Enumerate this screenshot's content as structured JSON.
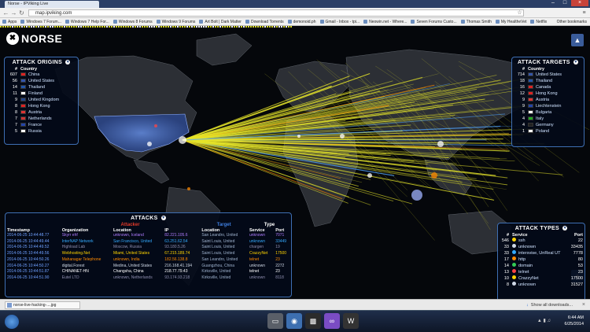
{
  "browser": {
    "tab_title": "Norse - IPViking Live",
    "url": "map.ipviking.com",
    "minimize": "–",
    "maximize": "□",
    "close": "×",
    "back": "←",
    "forward": "→",
    "reload": "↻",
    "star": "☆",
    "menu": "≡",
    "bookmarks": [
      "Apps",
      "Windows 7 Forum...",
      "Windows 7 Help For...",
      "Windows 8 Forums",
      "Windows 9 Forums",
      "Art Bolt | Dark Matter",
      "Download Torrents",
      "demonoid.ph",
      "Gmail - Inbox - tpi...",
      "Neowin.net - Where...",
      "Seven Forums Custo...",
      "Thomas Smith",
      "My HealtheVet",
      "Netflix"
    ],
    "other_bookmarks": "Other bookmarks"
  },
  "logo": {
    "mark": "✖",
    "text": "NORSE"
  },
  "map_buttons": {
    "top": "▲",
    "bottom": "✦"
  },
  "origins": {
    "title": "ATTACK ORIGINS",
    "chevron": "▼",
    "col_num": "#",
    "col_country": "Country",
    "rows": [
      {
        "count": "607",
        "country": "China",
        "flag": "#d22"
      },
      {
        "count": "56",
        "country": "United States",
        "flag": "#3355aa"
      },
      {
        "count": "14",
        "country": "Thailand",
        "flag": "#2255aa"
      },
      {
        "count": "11",
        "country": "Finland",
        "flag": "#ffffff"
      },
      {
        "count": "9",
        "country": "United Kingdom",
        "flag": "#224488"
      },
      {
        "count": "8",
        "country": "Hong Kong",
        "flag": "#d22"
      },
      {
        "count": "8",
        "country": "Austria",
        "flag": "#d33"
      },
      {
        "count": "7",
        "country": "Netherlands",
        "flag": "#c33"
      },
      {
        "count": "7",
        "country": "France",
        "flag": "#2244aa"
      },
      {
        "count": "5",
        "country": "Russia",
        "flag": "#ffffff"
      }
    ]
  },
  "targets": {
    "title": "ATTACK TARGETS",
    "chevron": "▼",
    "col_num": "#",
    "col_country": "Country",
    "rows": [
      {
        "count": "714",
        "country": "United States",
        "flag": "#3355aa"
      },
      {
        "count": "18",
        "country": "Thailand",
        "flag": "#2255aa"
      },
      {
        "count": "16",
        "country": "Canada",
        "flag": "#d22"
      },
      {
        "count": "12",
        "country": "Hong Kong",
        "flag": "#d22"
      },
      {
        "count": "9",
        "country": "Austria",
        "flag": "#d33"
      },
      {
        "count": "9",
        "country": "Liechtenstein",
        "flag": "#2244aa"
      },
      {
        "count": "5",
        "country": "Bulgaria",
        "flag": "#ffffff"
      },
      {
        "count": "4",
        "country": "Italy",
        "flag": "#2a2"
      },
      {
        "count": "4",
        "country": "Germany",
        "flag": "#222"
      },
      {
        "count": "1",
        "country": "Poland",
        "flag": "#ffffff"
      }
    ]
  },
  "types": {
    "title": "ATTACK TYPES",
    "chevron": "▼",
    "col_num": "#",
    "col_service": "Service",
    "col_port": "Port",
    "rows": [
      {
        "count": "546",
        "service": "ssh",
        "port": "22",
        "color": "#ffd400"
      },
      {
        "count": "33",
        "service": "unknown",
        "port": "33435",
        "color": "#cfd8e6"
      },
      {
        "count": "33",
        "service": "intersvise, UnReal UT",
        "port": "7778",
        "color": "#33aaff"
      },
      {
        "count": "17",
        "service": "http",
        "port": "80",
        "color": "#ff8a00"
      },
      {
        "count": "14",
        "service": "domain",
        "port": "53",
        "color": "#33cc55"
      },
      {
        "count": "13",
        "service": "telnet",
        "port": "23",
        "color": "#ff4444"
      },
      {
        "count": "10",
        "service": "CrazzyNet",
        "port": "17500",
        "color": "#ffd400"
      },
      {
        "count": "8",
        "service": "unknown",
        "port": "31527",
        "color": "#cfd8e6"
      }
    ]
  },
  "attacks": {
    "title": "ATTACKS",
    "chevron": "▼",
    "attacker_label": "Attacker",
    "target_label": "Target",
    "type_label": "Type",
    "columns": [
      "Timestamp",
      "Organization",
      "Location",
      "IP",
      "Location",
      "Service",
      "Port"
    ],
    "rows": [
      {
        "ts": "2014-06-25 10:44:48.77",
        "org": "Skyrr ehf",
        "loc": "unknown, Iceland",
        "ip": "82.221.105.6",
        "tloc": "San Leandro, United",
        "svc": "unknown",
        "port": "7071",
        "color": "#b07cff"
      },
      {
        "ts": "2014-06-25 10:44:49.44",
        "org": "InterNAP Network",
        "loc": "San Francisco, United",
        "ip": "63.251.62.54",
        "tloc": "Saint Louis, United",
        "svc": "unknown",
        "port": "33449",
        "color": "#33aaff"
      },
      {
        "ts": "2014-06-25 10:44:49.52",
        "org": "Highload Lab",
        "loc": "Moscow, Russia",
        "ip": "93.180.5.26",
        "tloc": "Saint Louis, United",
        "svc": "chargen",
        "port": "19",
        "color": "#8f8fb0"
      },
      {
        "ts": "2014-06-25 10:44:49.56",
        "org": "Webhosting.Net",
        "loc": "Miami, United States",
        "ip": "67.215.189.74",
        "tloc": "Saint Louis, United",
        "svc": "CrazzyNet",
        "port": "17500",
        "color": "#ffd400"
      },
      {
        "ts": "2014-06-25 10:44:50.26",
        "org": "Mahanagar Telephone",
        "loc": "unknown, India",
        "ip": "182.56.138.8",
        "tloc": "San Leandro, United",
        "svc": "telnet",
        "port": "23",
        "color": "#ff8a00"
      },
      {
        "ts": "2014-06-25 10:44:50.27",
        "org": "digital.Forest",
        "loc": "Medina, United States",
        "ip": "216.168.41.194",
        "tloc": "Guangzhou, China",
        "svc": "unknown",
        "port": "2272",
        "color": "#cfd8e6"
      },
      {
        "ts": "2014-06-25 10:44:51.87",
        "org": "CHINANET-HN",
        "loc": "Changsha, China",
        "ip": "218.77.79.43",
        "tloc": "Kirksville, United",
        "svc": "telnet",
        "port": "23",
        "color": "#ffffff"
      },
      {
        "ts": "2014-06-25 10:44:51.90",
        "org": "Eutel LTD",
        "loc": "unknown, Netherlands",
        "ip": "93.174.93.218",
        "tloc": "Kirksville, United",
        "svc": "unknown",
        "port": "8118",
        "color": "#8f8fb0"
      }
    ]
  },
  "download": {
    "file": "norse-live-hacking-....jpg",
    "show_all": "Show all downloads...",
    "close": "×"
  },
  "taskbar": {
    "time": "6:44 AM",
    "date": "6/25/2014"
  }
}
